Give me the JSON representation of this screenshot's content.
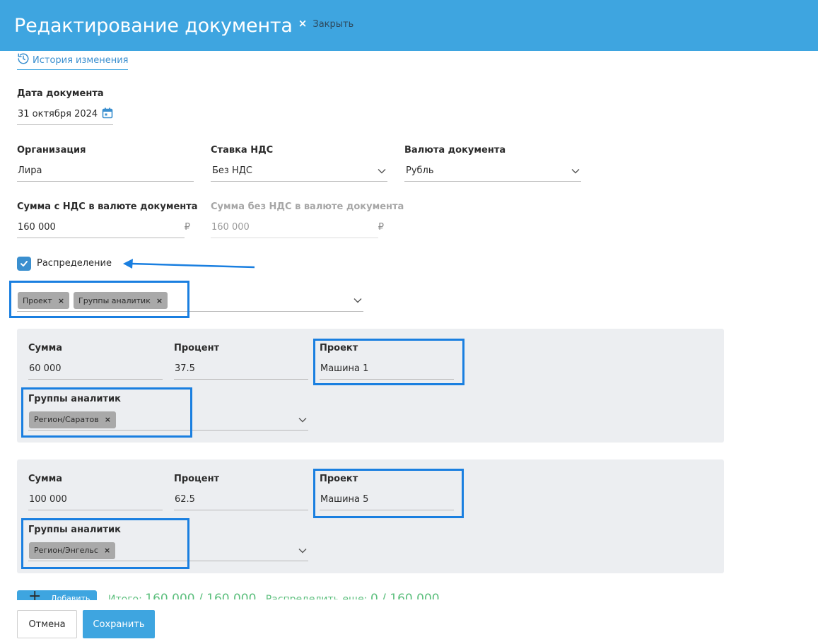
{
  "header": {
    "title": "Редактирование документа",
    "close_x": "×",
    "close_label": "Закрыть",
    "color": "#3ea5e0"
  },
  "history": {
    "label": "История изменения",
    "icon": "history-icon"
  },
  "doc_date": {
    "label": "Дата документа",
    "value": "31 октября 2024",
    "icon": "calendar-icon"
  },
  "organization": {
    "label": "Организация",
    "value": "Лира"
  },
  "vat_rate": {
    "label": "Ставка НДС",
    "value": "Без НДС"
  },
  "currency": {
    "label": "Валюта документа",
    "value": "Рубль"
  },
  "sum_with_vat": {
    "label": "Сумма с НДС в валюте документа",
    "value": "160 000",
    "currency_symbol": "₽"
  },
  "sum_without_vat": {
    "label": "Сумма без НДС в валюте документа",
    "value": "160 000",
    "currency_symbol": "₽"
  },
  "distribution": {
    "label": "Распределение",
    "checked": true
  },
  "dimensions": {
    "tags": [
      {
        "label": "Проект",
        "remove": "×"
      },
      {
        "label": "Группы аналитик",
        "remove": "×"
      }
    ]
  },
  "rows": [
    {
      "sum_label": "Сумма",
      "sum_value": "60 000",
      "percent_label": "Процент",
      "percent_value": "37.5",
      "project_label": "Проект",
      "project_value": "Машина 1",
      "groups_label": "Группы аналитик",
      "groups_tags": [
        {
          "label": "Регион/Саратов",
          "remove": "×"
        }
      ]
    },
    {
      "sum_label": "Сумма",
      "sum_value": "100 000",
      "percent_label": "Процент",
      "percent_value": "62.5",
      "project_label": "Проект",
      "project_value": "Машина 5",
      "groups_label": "Группы аналитик",
      "groups_tags": [
        {
          "label": "Регион/Энгельс",
          "remove": "×"
        }
      ]
    }
  ],
  "footer": {
    "add_label": "Добавить",
    "add_icon": "plus-icon",
    "totals_prefix": "Итого:",
    "totals_value": "160 000 / 160 000",
    "remaining_prefix": "Распределить еще:",
    "remaining_value": "0 / 160 000",
    "cancel_label": "Отмена",
    "save_label": "Сохранить"
  },
  "colors": {
    "accent": "#3ea5e0",
    "annotation": "#1a7fe0",
    "panel": "#eceef1",
    "success": "#5cbf7d"
  }
}
